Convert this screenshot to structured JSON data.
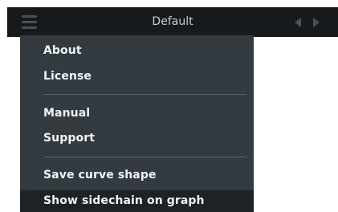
{
  "header": {
    "preset_name": "Default",
    "menu_icon": "hamburger-menu-icon",
    "prev_icon": "triangle-left-icon",
    "next_icon": "triangle-right-icon"
  },
  "menu": {
    "groups": [
      [
        "About",
        "License"
      ],
      [
        "Manual",
        "Support"
      ],
      [
        "Save curve shape",
        "Show sidechain on graph"
      ]
    ],
    "highlighted_item": "Show sidechain on graph"
  }
}
